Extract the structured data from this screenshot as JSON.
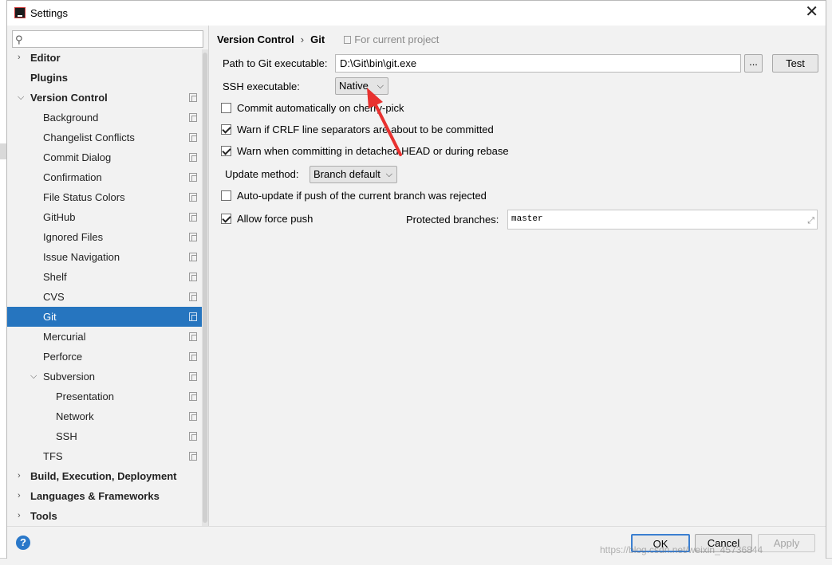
{
  "window": {
    "title": "Settings"
  },
  "search": {
    "placeholder": "",
    "value": ""
  },
  "sidebar": {
    "items": [
      {
        "label": "Editor",
        "level": 0,
        "bold": true,
        "expandable": true,
        "expanded": false,
        "project_icon": false
      },
      {
        "label": "Plugins",
        "level": 0,
        "bold": true,
        "expandable": false,
        "project_icon": false
      },
      {
        "label": "Version Control",
        "level": 0,
        "bold": true,
        "expandable": true,
        "expanded": true,
        "project_icon": true
      },
      {
        "label": "Background",
        "level": 1,
        "project_icon": true
      },
      {
        "label": "Changelist Conflicts",
        "level": 1,
        "project_icon": true
      },
      {
        "label": "Commit Dialog",
        "level": 1,
        "project_icon": true
      },
      {
        "label": "Confirmation",
        "level": 1,
        "project_icon": true
      },
      {
        "label": "File Status Colors",
        "level": 1,
        "project_icon": true
      },
      {
        "label": "GitHub",
        "level": 1,
        "project_icon": true
      },
      {
        "label": "Ignored Files",
        "level": 1,
        "project_icon": true
      },
      {
        "label": "Issue Navigation",
        "level": 1,
        "project_icon": true
      },
      {
        "label": "Shelf",
        "level": 1,
        "project_icon": true
      },
      {
        "label": "CVS",
        "level": 1,
        "project_icon": true
      },
      {
        "label": "Git",
        "level": 1,
        "project_icon": true,
        "selected": true
      },
      {
        "label": "Mercurial",
        "level": 1,
        "project_icon": true
      },
      {
        "label": "Perforce",
        "level": 1,
        "project_icon": true
      },
      {
        "label": "Subversion",
        "level": 1,
        "expandable": true,
        "expanded": true,
        "project_icon": true
      },
      {
        "label": "Presentation",
        "level": 2,
        "project_icon": true
      },
      {
        "label": "Network",
        "level": 2,
        "project_icon": true
      },
      {
        "label": "SSH",
        "level": 2,
        "project_icon": true
      },
      {
        "label": "TFS",
        "level": 1,
        "project_icon": true
      },
      {
        "label": "Build, Execution, Deployment",
        "level": 0,
        "bold": true,
        "expandable": true,
        "expanded": false,
        "project_icon": false
      },
      {
        "label": "Languages & Frameworks",
        "level": 0,
        "bold": true,
        "expandable": true,
        "expanded": false,
        "project_icon": false
      },
      {
        "label": "Tools",
        "level": 0,
        "bold": true,
        "expandable": true,
        "expanded": false,
        "project_icon": false
      }
    ]
  },
  "breadcrumb": {
    "parent": "Version Control",
    "separator": "›",
    "current": "Git",
    "scope": "For current project"
  },
  "git": {
    "path_label": "Path to Git executable:",
    "path_value": "D:\\Git\\bin\\git.exe",
    "browse_label": "...",
    "test_label": "Test",
    "ssh_label": "SSH executable:",
    "ssh_value": "Native",
    "commit_auto_label": "Commit automatically on cherry-pick",
    "commit_auto_checked": false,
    "crlf_label": "Warn if CRLF line separators are about to be committed",
    "crlf_checked": true,
    "detached_label": "Warn when committing in detached HEAD or during rebase",
    "detached_checked": true,
    "update_method_label": "Update method:",
    "update_method_value": "Branch default",
    "auto_update_label": "Auto-update if push of the current branch was rejected",
    "auto_update_checked": false,
    "force_push_label": "Allow force push",
    "force_push_checked": true,
    "protected_label": "Protected branches:",
    "protected_value": "master"
  },
  "footer": {
    "help_label": "?",
    "ok_label": "OK",
    "cancel_label": "Cancel",
    "apply_label": "Apply"
  },
  "watermark": "https://blog.csdn.net/weixin_45736844",
  "colors": {
    "selection": "#2675bf",
    "accent": "#3b7fd1",
    "annotation_arrow": "#e8312f"
  }
}
